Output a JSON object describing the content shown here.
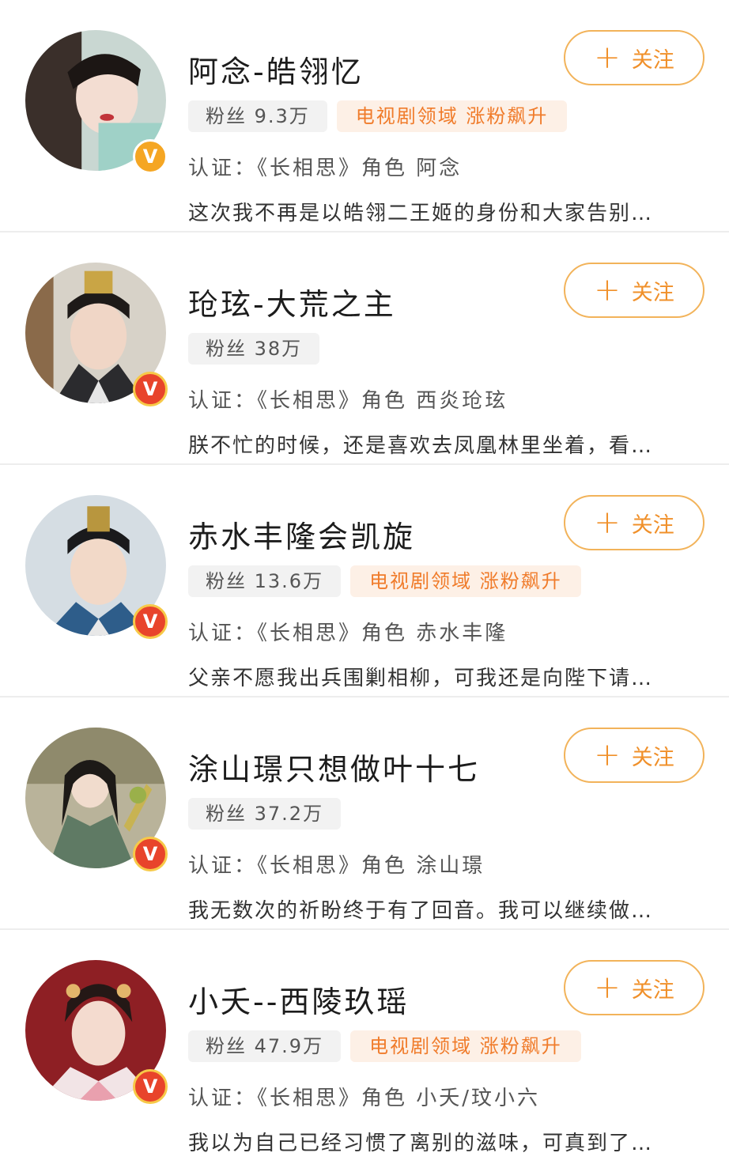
{
  "follow_label": "关注",
  "follow_icon": "plus-icon",
  "verified_icon": "v-verified-icon",
  "colors": {
    "accent": "#f0902a",
    "follow_border": "#f2b35a",
    "rank_text": "#f07b2a",
    "rank_bg": "#fdf0e6",
    "fans_bg": "#f2f2f2",
    "badge_orange": "#f5a623",
    "badge_red": "#e8442b"
  },
  "accounts": [
    {
      "name": "阿念-皓翎忆",
      "fans": "粉丝 9.3万",
      "rank": "电视剧领域 涨粉飙升",
      "verify": "认证：《长相思》角色 阿念",
      "desc": "这次我不再是以皓翎二王姬的身份和大家告别…"
    },
    {
      "name": "玱玹-大荒之主",
      "fans": "粉丝 38万",
      "rank": "",
      "verify": "认证：《长相思》角色 西炎玱玹",
      "desc": "朕不忙的时候，还是喜欢去凤凰林里坐着，看…"
    },
    {
      "name": "赤水丰隆会凯旋",
      "fans": "粉丝 13.6万",
      "rank": "电视剧领域 涨粉飙升",
      "verify": "认证：《长相思》角色 赤水丰隆",
      "desc": "父亲不愿我出兵围剿相柳，可我还是向陛下请…"
    },
    {
      "name": "涂山璟只想做叶十七",
      "fans": "粉丝 37.2万",
      "rank": "",
      "verify": "认证：《长相思》角色 涂山璟",
      "desc": "我无数次的祈盼终于有了回音。我可以继续做…"
    },
    {
      "name": "小夭--西陵玖瑶",
      "fans": "粉丝 47.9万",
      "rank": "电视剧领域 涨粉飙升",
      "verify": "认证：《长相思》角色 小夭/玟小六",
      "desc": "我以为自己已经习惯了离别的滋味，可真到了…"
    }
  ]
}
